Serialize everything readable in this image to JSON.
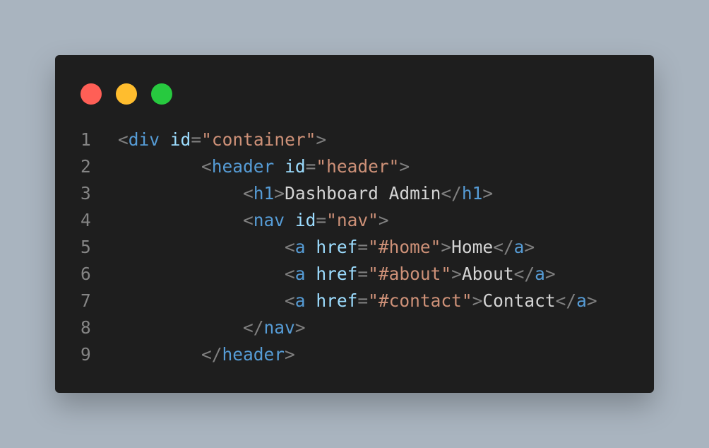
{
  "window": {
    "dots": [
      {
        "name": "close",
        "color": "#ff5f56"
      },
      {
        "name": "minimize",
        "color": "#ffbd2e"
      },
      {
        "name": "maximize",
        "color": "#27c93f"
      }
    ]
  },
  "colors": {
    "background": "#a9b4bf",
    "editor": "#1e1e1e",
    "line_number": "#858585",
    "tag": "#569cd6",
    "punctuation": "#808080",
    "attribute": "#9cdcfe",
    "string": "#ce9178",
    "text": "#d4d4d4"
  },
  "code": {
    "lines": [
      {
        "num": "1",
        "indent": "",
        "tokens": [
          {
            "t": "punct",
            "v": "<"
          },
          {
            "t": "tag",
            "v": "div"
          },
          {
            "t": "txt",
            "v": " "
          },
          {
            "t": "attr",
            "v": "id"
          },
          {
            "t": "punct",
            "v": "="
          },
          {
            "t": "str",
            "v": "\"container\""
          },
          {
            "t": "punct",
            "v": ">"
          }
        ]
      },
      {
        "num": "2",
        "indent": "        ",
        "tokens": [
          {
            "t": "punct",
            "v": "<"
          },
          {
            "t": "tag",
            "v": "header"
          },
          {
            "t": "txt",
            "v": " "
          },
          {
            "t": "attr",
            "v": "id"
          },
          {
            "t": "punct",
            "v": "="
          },
          {
            "t": "str",
            "v": "\"header\""
          },
          {
            "t": "punct",
            "v": ">"
          }
        ]
      },
      {
        "num": "3",
        "indent": "            ",
        "tokens": [
          {
            "t": "punct",
            "v": "<"
          },
          {
            "t": "tag",
            "v": "h1"
          },
          {
            "t": "punct",
            "v": ">"
          },
          {
            "t": "txt",
            "v": "Dashboard Admin"
          },
          {
            "t": "punct",
            "v": "</"
          },
          {
            "t": "tag",
            "v": "h1"
          },
          {
            "t": "punct",
            "v": ">"
          }
        ]
      },
      {
        "num": "4",
        "indent": "            ",
        "tokens": [
          {
            "t": "punct",
            "v": "<"
          },
          {
            "t": "tag",
            "v": "nav"
          },
          {
            "t": "txt",
            "v": " "
          },
          {
            "t": "attr",
            "v": "id"
          },
          {
            "t": "punct",
            "v": "="
          },
          {
            "t": "str",
            "v": "\"nav\""
          },
          {
            "t": "punct",
            "v": ">"
          }
        ]
      },
      {
        "num": "5",
        "indent": "                ",
        "tokens": [
          {
            "t": "punct",
            "v": "<"
          },
          {
            "t": "tag",
            "v": "a"
          },
          {
            "t": "txt",
            "v": " "
          },
          {
            "t": "attr",
            "v": "href"
          },
          {
            "t": "punct",
            "v": "="
          },
          {
            "t": "str",
            "v": "\"#home\""
          },
          {
            "t": "punct",
            "v": ">"
          },
          {
            "t": "txt",
            "v": "Home"
          },
          {
            "t": "punct",
            "v": "</"
          },
          {
            "t": "tag",
            "v": "a"
          },
          {
            "t": "punct",
            "v": ">"
          }
        ]
      },
      {
        "num": "6",
        "indent": "                ",
        "tokens": [
          {
            "t": "punct",
            "v": "<"
          },
          {
            "t": "tag",
            "v": "a"
          },
          {
            "t": "txt",
            "v": " "
          },
          {
            "t": "attr",
            "v": "href"
          },
          {
            "t": "punct",
            "v": "="
          },
          {
            "t": "str",
            "v": "\"#about\""
          },
          {
            "t": "punct",
            "v": ">"
          },
          {
            "t": "txt",
            "v": "About"
          },
          {
            "t": "punct",
            "v": "</"
          },
          {
            "t": "tag",
            "v": "a"
          },
          {
            "t": "punct",
            "v": ">"
          }
        ]
      },
      {
        "num": "7",
        "indent": "                ",
        "tokens": [
          {
            "t": "punct",
            "v": "<"
          },
          {
            "t": "tag",
            "v": "a"
          },
          {
            "t": "txt",
            "v": " "
          },
          {
            "t": "attr",
            "v": "href"
          },
          {
            "t": "punct",
            "v": "="
          },
          {
            "t": "str",
            "v": "\"#contact\""
          },
          {
            "t": "punct",
            "v": ">"
          },
          {
            "t": "txt",
            "v": "Contact"
          },
          {
            "t": "punct",
            "v": "</"
          },
          {
            "t": "tag",
            "v": "a"
          },
          {
            "t": "punct",
            "v": ">"
          }
        ]
      },
      {
        "num": "8",
        "indent": "            ",
        "tokens": [
          {
            "t": "punct",
            "v": "</"
          },
          {
            "t": "tag",
            "v": "nav"
          },
          {
            "t": "punct",
            "v": ">"
          }
        ]
      },
      {
        "num": "9",
        "indent": "        ",
        "tokens": [
          {
            "t": "punct",
            "v": "</"
          },
          {
            "t": "tag",
            "v": "header"
          },
          {
            "t": "punct",
            "v": ">"
          }
        ]
      }
    ]
  }
}
